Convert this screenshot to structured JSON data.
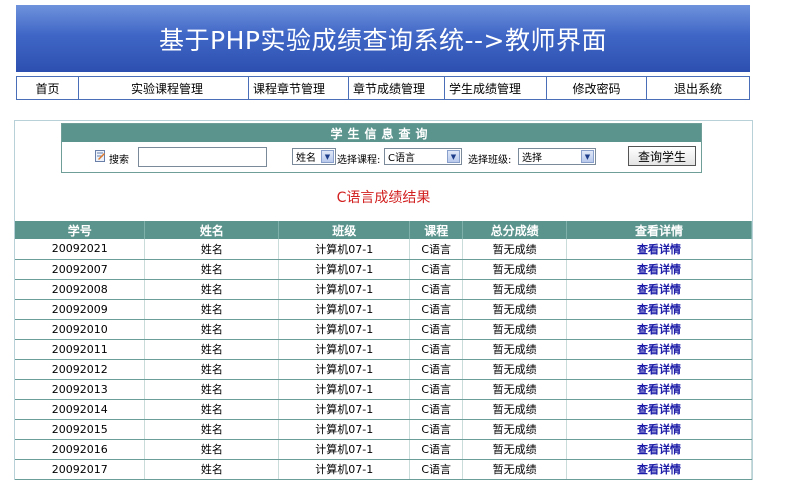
{
  "banner": {
    "title": "基于PHP实验成绩查询系统-->教师界面"
  },
  "nav": [
    {
      "label": "首页"
    },
    {
      "label": "实验课程管理"
    },
    {
      "label": "课程章节管理"
    },
    {
      "label": "章节成绩管理"
    },
    {
      "label": "学生成绩管理"
    },
    {
      "label": "修改密码"
    },
    {
      "label": "退出系统"
    }
  ],
  "query": {
    "title": "学生信息查询",
    "search_label": "搜索",
    "search_value": "",
    "field_select": "姓名",
    "course_label": "选择课程:",
    "course_select": "C语言",
    "class_label": "选择班级:",
    "class_select": "选择",
    "button": "查询学生"
  },
  "result_title": "C语言成绩结果",
  "table": {
    "columns": [
      "学号",
      "姓名",
      "班级",
      "课程",
      "总分成绩",
      "查看详情"
    ],
    "rows": [
      [
        "20092021",
        "姓名",
        "计算机07-1",
        "C语言",
        "暂无成绩",
        "查看详情"
      ],
      [
        "20092007",
        "姓名",
        "计算机07-1",
        "C语言",
        "暂无成绩",
        "查看详情"
      ],
      [
        "20092008",
        "姓名",
        "计算机07-1",
        "C语言",
        "暂无成绩",
        "查看详情"
      ],
      [
        "20092009",
        "姓名",
        "计算机07-1",
        "C语言",
        "暂无成绩",
        "查看详情"
      ],
      [
        "20092010",
        "姓名",
        "计算机07-1",
        "C语言",
        "暂无成绩",
        "查看详情"
      ],
      [
        "20092011",
        "姓名",
        "计算机07-1",
        "C语言",
        "暂无成绩",
        "查看详情"
      ],
      [
        "20092012",
        "姓名",
        "计算机07-1",
        "C语言",
        "暂无成绩",
        "查看详情"
      ],
      [
        "20092013",
        "姓名",
        "计算机07-1",
        "C语言",
        "暂无成绩",
        "查看详情"
      ],
      [
        "20092014",
        "姓名",
        "计算机07-1",
        "C语言",
        "暂无成绩",
        "查看详情"
      ],
      [
        "20092015",
        "姓名",
        "计算机07-1",
        "C语言",
        "暂无成绩",
        "查看详情"
      ],
      [
        "20092016",
        "姓名",
        "计算机07-1",
        "C语言",
        "暂无成绩",
        "查看详情"
      ],
      [
        "20092017",
        "姓名",
        "计算机07-1",
        "C语言",
        "暂无成绩",
        "查看详情"
      ]
    ]
  },
  "colors": {
    "banner": "#3f66c6",
    "table_header": "#5b948d",
    "result_title": "#d21f1f",
    "link": "#1c1ca8"
  }
}
